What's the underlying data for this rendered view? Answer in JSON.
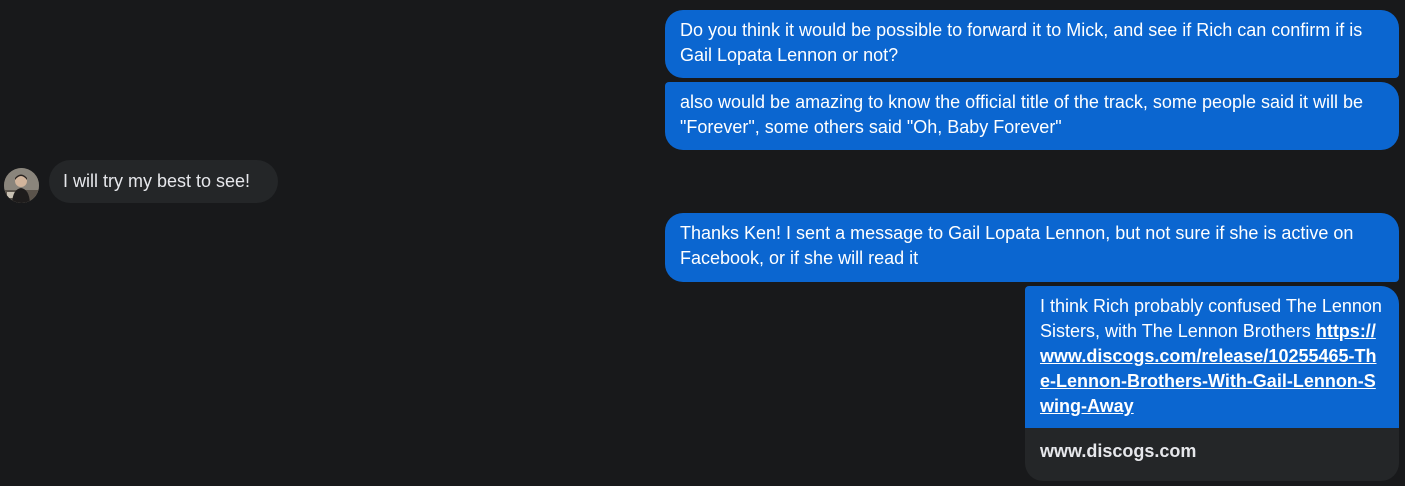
{
  "messages": [
    {
      "direction": "outgoing",
      "text": "Do you think it would be possible to forward it to Mick, and see if Rich can confirm if is Gail Lopata Lennon or not?"
    },
    {
      "direction": "outgoing",
      "text": "also would be amazing to know the official title of the track, some people said it will be \"Forever\", some others said \"Oh, Baby Forever\""
    },
    {
      "direction": "incoming",
      "text": "I will try my best to see!"
    },
    {
      "direction": "outgoing",
      "text": "Thanks Ken! I sent a message to Gail Lopata Lennon, but not sure if she is active on Facebook, or if she will read it"
    },
    {
      "direction": "outgoing",
      "text": "I think Rich probably confused The Lennon Sisters, with The Lennon Brothers",
      "link": "https://www.discogs.com/release/10255465-The-Lennon-Brothers-With-Gail-Lennon-Swing-Away",
      "preview_domain": "www.discogs.com"
    }
  ],
  "colors": {
    "background": "#18191b",
    "outgoing_bubble": "#0b66d0",
    "incoming_bubble": "#242628"
  }
}
